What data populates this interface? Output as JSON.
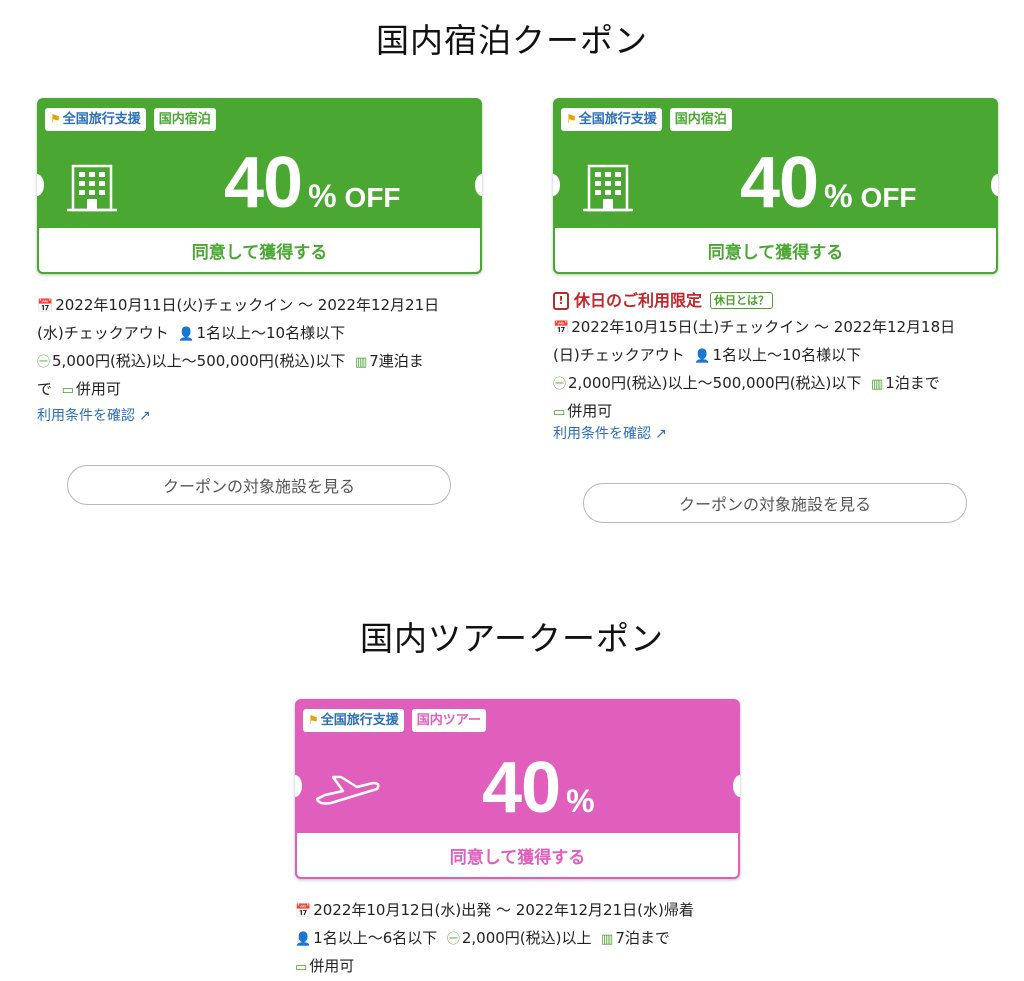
{
  "colors": {
    "green": "#4aa832",
    "pink": "#e05fbd",
    "link": "#2a6fb7",
    "holiday_red": "#c0272d"
  },
  "sections": {
    "lodging_title": "国内宿泊クーポン",
    "tour_title": "国内ツアークーポン"
  },
  "coupons": [
    {
      "badge_national": "全国旅行支援",
      "badge_type": "国内宿泊",
      "icon": "building-icon",
      "discount_num": "40",
      "discount_pct": "%",
      "discount_off": "OFF",
      "cta": "同意して獲得する",
      "lines": [
        "2022年10月11日(火)チェックイン 〜 2022年12月21日",
        "(水)チェックアウト",
        "1名以上〜10名様以下",
        "5,000円(税込)以上〜500,000円(税込)以下",
        "7連泊ま",
        "で",
        "併用可"
      ],
      "terms": "利用条件を確認",
      "facility_button": "クーポンの対象施設を見る"
    },
    {
      "badge_national": "全国旅行支援",
      "badge_type": "国内宿泊",
      "icon": "building-icon",
      "discount_num": "40",
      "discount_pct": "%",
      "discount_off": "OFF",
      "cta": "同意して獲得する",
      "holiday_label": "休日のご利用限定",
      "holiday_badge": "休日とは？",
      "lines": [
        "2022年10月15日(土)チェックイン 〜 2022年12月18日",
        "(日)チェックアウト",
        "1名以上〜10名様以下",
        "2,000円(税込)以上〜500,000円(税込)以下",
        "1泊まで",
        "併用可"
      ],
      "terms": "利用条件を確認",
      "facility_button": "クーポンの対象施設を見る"
    },
    {
      "badge_national": "全国旅行支援",
      "badge_type": "国内ツアー",
      "icon": "airplane-icon",
      "discount_num": "40",
      "discount_pct": "%",
      "cta": "同意して獲得する",
      "lines": [
        "2022年10月12日(水)出発 〜 2022年12月21日(水)帰着",
        "1名以上〜6名以下",
        "2,000円(税込)以上",
        "7泊まで",
        "併用可"
      ]
    }
  ]
}
